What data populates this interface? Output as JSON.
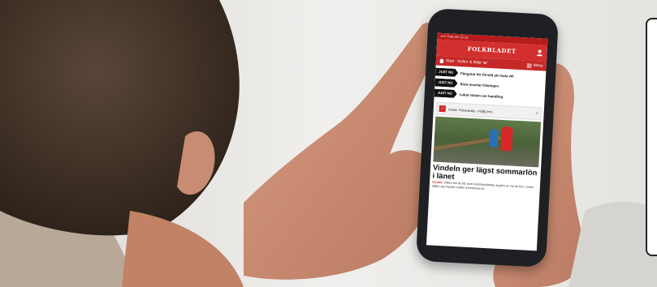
{
  "app": {
    "status_bar": "••••• Telia 4G      13:18",
    "masthead": "FOLKBLADET",
    "login_label": "Logga in"
  },
  "menu": {
    "home_label": "Start",
    "category_label": "Kultur & Nöje",
    "menu_label": "Meny"
  },
  "tickers": [
    {
      "tag": "JUST NU",
      "text": "Fångstar för förvild att mula vill"
    },
    {
      "tag": "JUST NU",
      "text": "Slow avselar träningen"
    },
    {
      "tag": "JUST NU",
      "text": "Lokat rösten om handling"
    }
  ],
  "alert": {
    "text": "Umeå: Fiskevänlig - möjlig insl...",
    "close": "×"
  },
  "article": {
    "headline": "Vindeln ger lägst sommarlön i länet",
    "place": "Vyuser.",
    "ingress": "Vilken lön du får som sommarjobbare avgörs av var du bor. Lönen skiljer sig mycket mellan kommunerna."
  },
  "colors": {
    "brand_red": "#d32f2f",
    "dark_red": "#c62828",
    "ticker_black": "#111111"
  }
}
